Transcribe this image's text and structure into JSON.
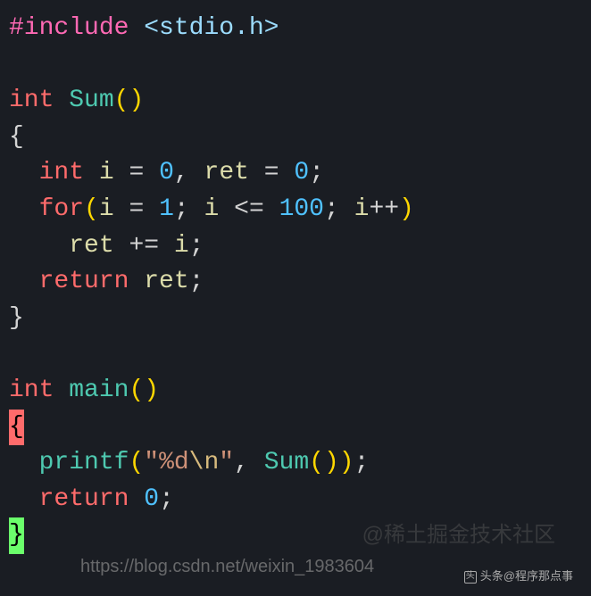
{
  "code": {
    "line1_include": "#include",
    "line1_path": "<stdio.h>",
    "line3_type": "int",
    "line3_func": "Sum",
    "line4_brace": "{",
    "line5_type": "int",
    "line5_var1": "i",
    "line5_eq1": "=",
    "line5_val1": "0",
    "line5_comma": ",",
    "line5_var2": "ret",
    "line5_eq2": "=",
    "line5_val2": "0",
    "line5_semi": ";",
    "line6_for": "for",
    "line6_var1": "i",
    "line6_eq1": "=",
    "line6_val1": "1",
    "line6_semi1": ";",
    "line6_var2": "i",
    "line6_op": "<=",
    "line6_val2": "100",
    "line6_semi2": ";",
    "line6_var3": "i",
    "line6_inc": "++",
    "line7_var1": "ret",
    "line7_op": "+=",
    "line7_var2": "i",
    "line7_semi": ";",
    "line8_return": "return",
    "line8_var": "ret",
    "line8_semi": ";",
    "line9_brace": "}",
    "line11_type": "int",
    "line11_func": "main",
    "line12_brace": "{",
    "line13_func": "printf",
    "line13_str1": "\"",
    "line13_fmt": "%d",
    "line13_esc": "\\n",
    "line13_str2": "\"",
    "line13_comma": ",",
    "line13_call": "Sum",
    "line13_semi": ";",
    "line14_return": "return",
    "line14_val": "0",
    "line14_semi": ";",
    "line15_brace": "}"
  },
  "watermark": {
    "text": "@稀土掘金技术社区",
    "url": "https://blog.csdn.net/weixin_1983604"
  },
  "footer": {
    "icon": "头",
    "text": "头条@程序那点事"
  }
}
